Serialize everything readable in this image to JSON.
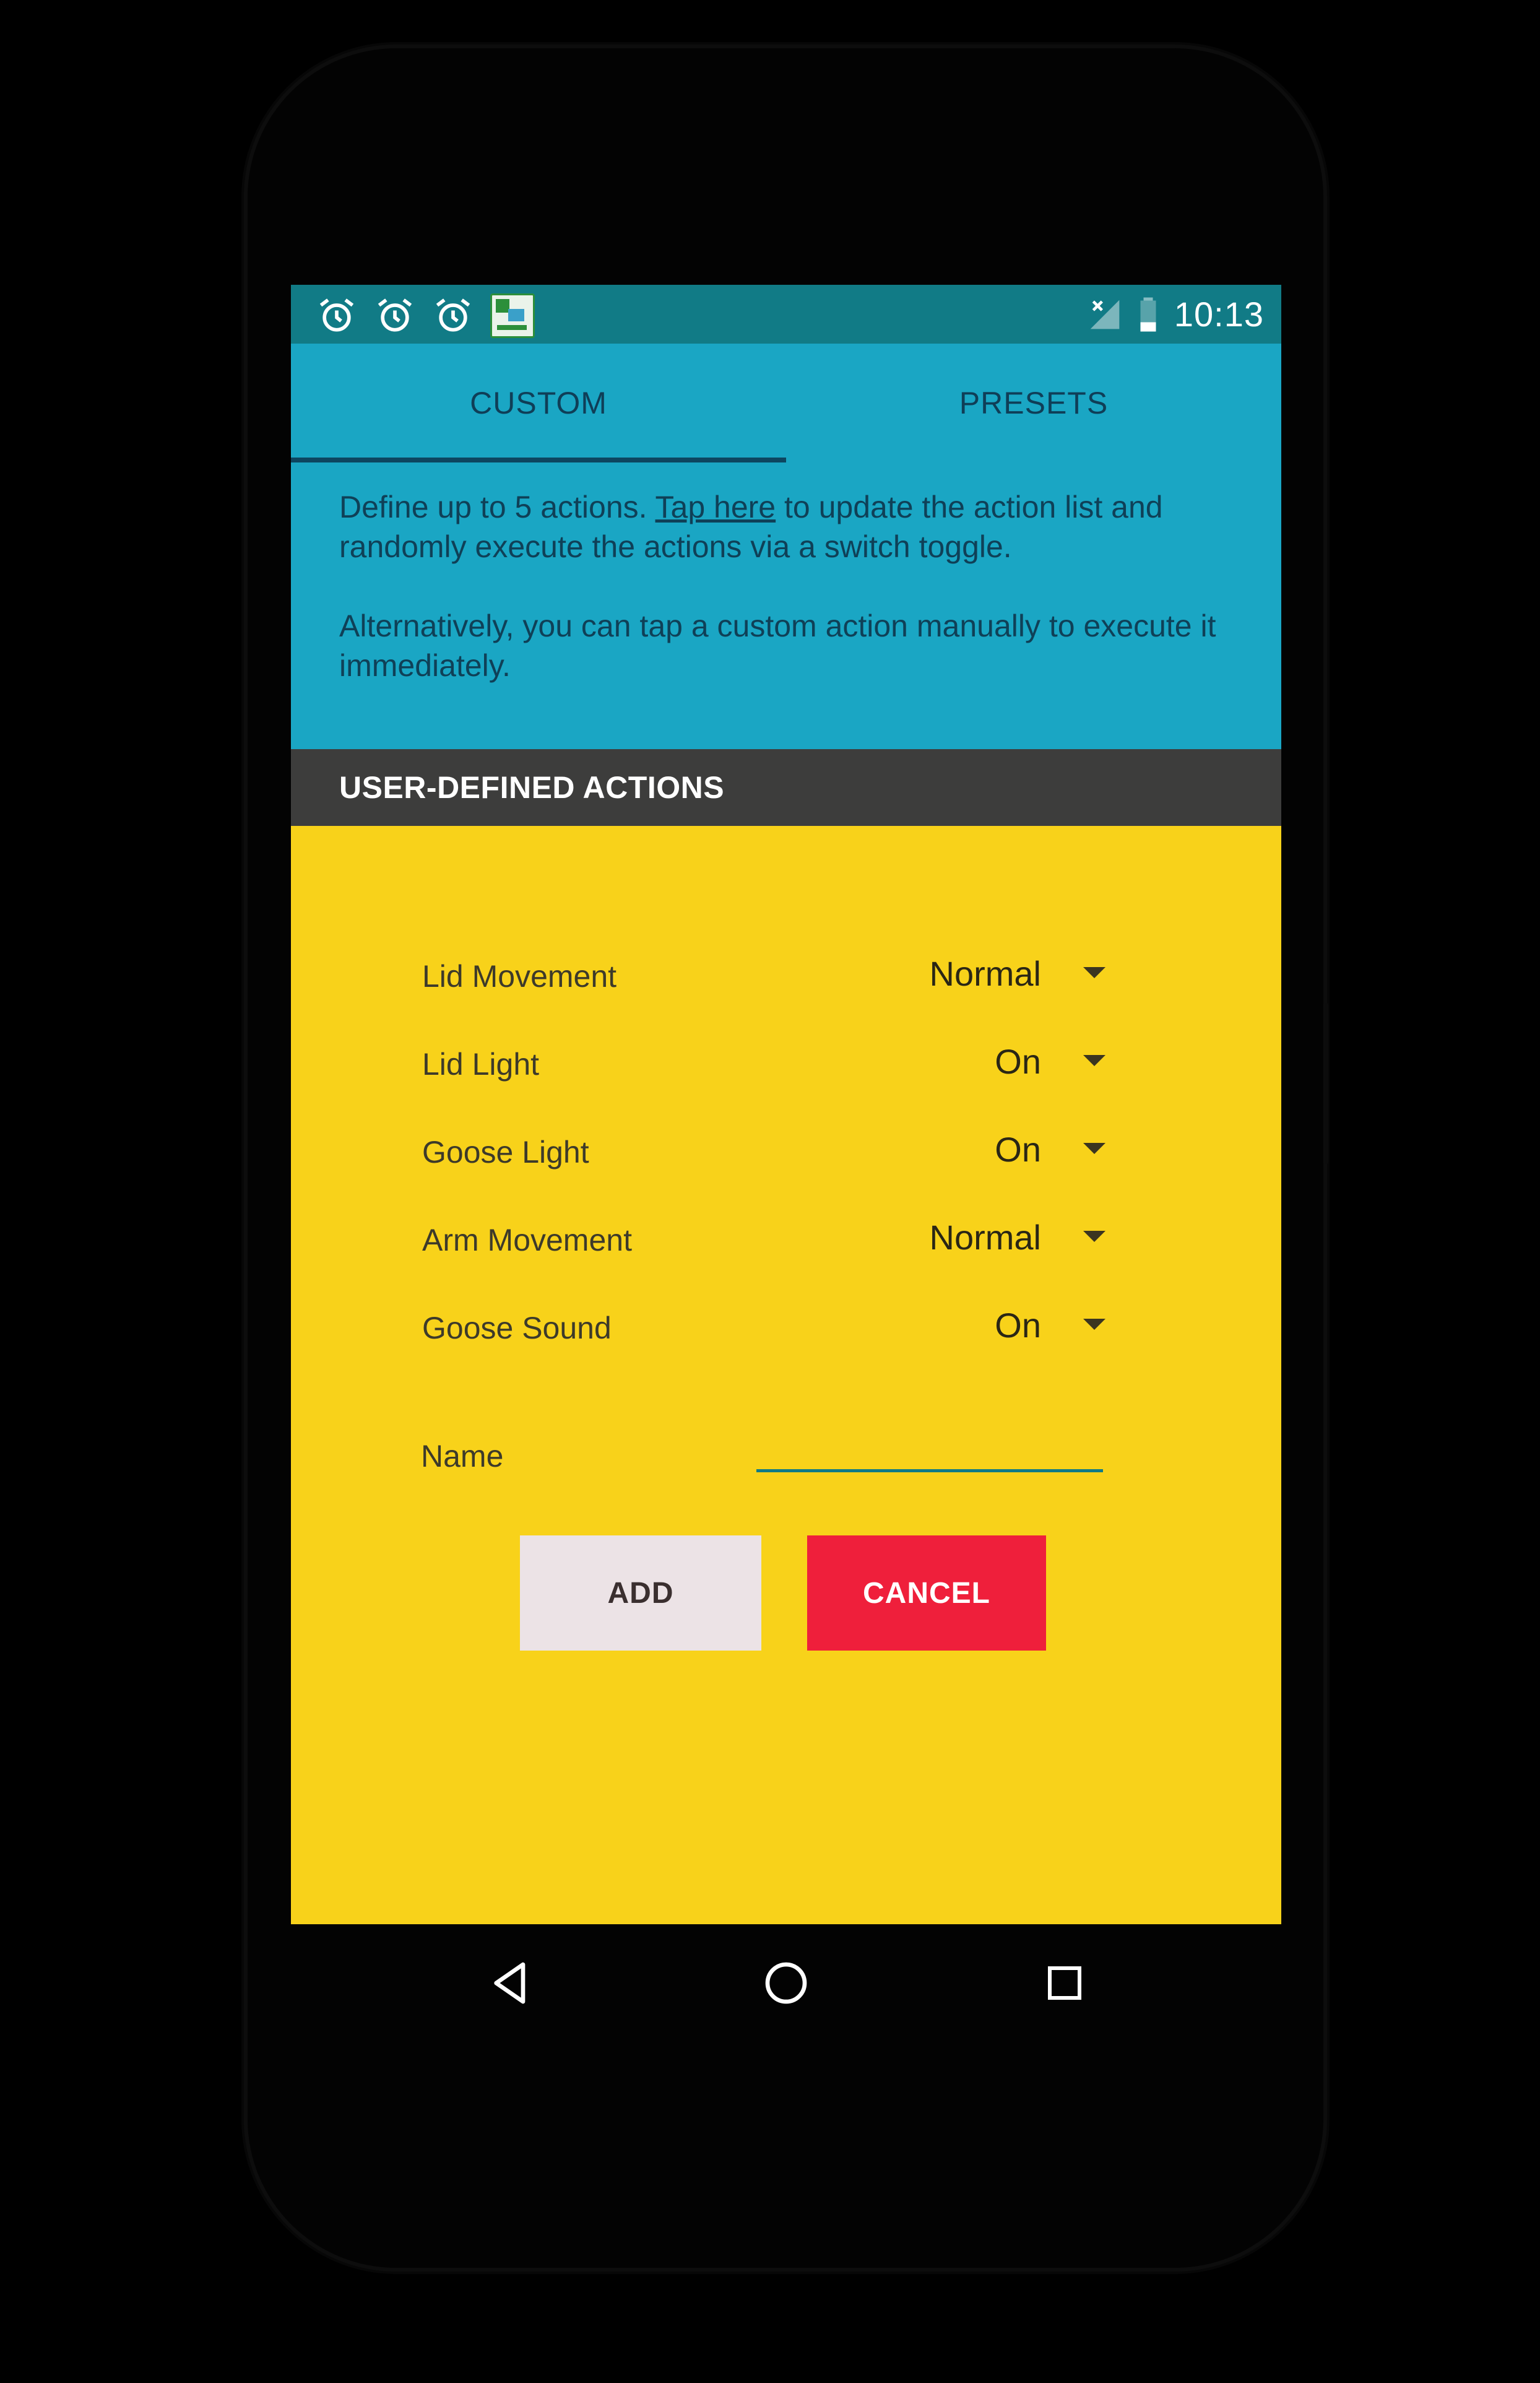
{
  "status_bar": {
    "time": "10:13",
    "icons": [
      "alarm-icon",
      "alarm-icon",
      "alarm-icon",
      "app-notification-icon",
      "no-signal-icon",
      "battery-icon"
    ]
  },
  "tabs": [
    {
      "label": "CUSTOM",
      "selected": true
    },
    {
      "label": "PRESETS",
      "selected": false
    }
  ],
  "info": {
    "line1_before": "Define up to 5 actions. ",
    "link_text": "Tap here",
    "line1_after": " to update the action list and randomly execute the actions via a switch toggle.",
    "line2": "Alternatively, you can tap a custom action manually to execute it immediately."
  },
  "section_title": "USER-DEFINED ACTIONS",
  "form": {
    "rows": [
      {
        "label": "Lid Movement",
        "value": "Normal"
      },
      {
        "label": "Lid Light",
        "value": "On"
      },
      {
        "label": "Goose Light",
        "value": "On"
      },
      {
        "label": "Arm Movement",
        "value": "Normal"
      },
      {
        "label": "Goose Sound",
        "value": "On"
      }
    ],
    "name_label": "Name",
    "name_value": ""
  },
  "buttons": {
    "add": "ADD",
    "cancel": "CANCEL"
  },
  "colors": {
    "status_bar": "#117b86",
    "tab_bar": "#1aa6c4",
    "section_header": "#3d3d3c",
    "form_background": "#f8d21a",
    "add_button": "#ece3e6",
    "cancel_button": "#ef1f3b"
  },
  "nav_bar": [
    "back-icon",
    "home-icon",
    "recents-icon"
  ]
}
